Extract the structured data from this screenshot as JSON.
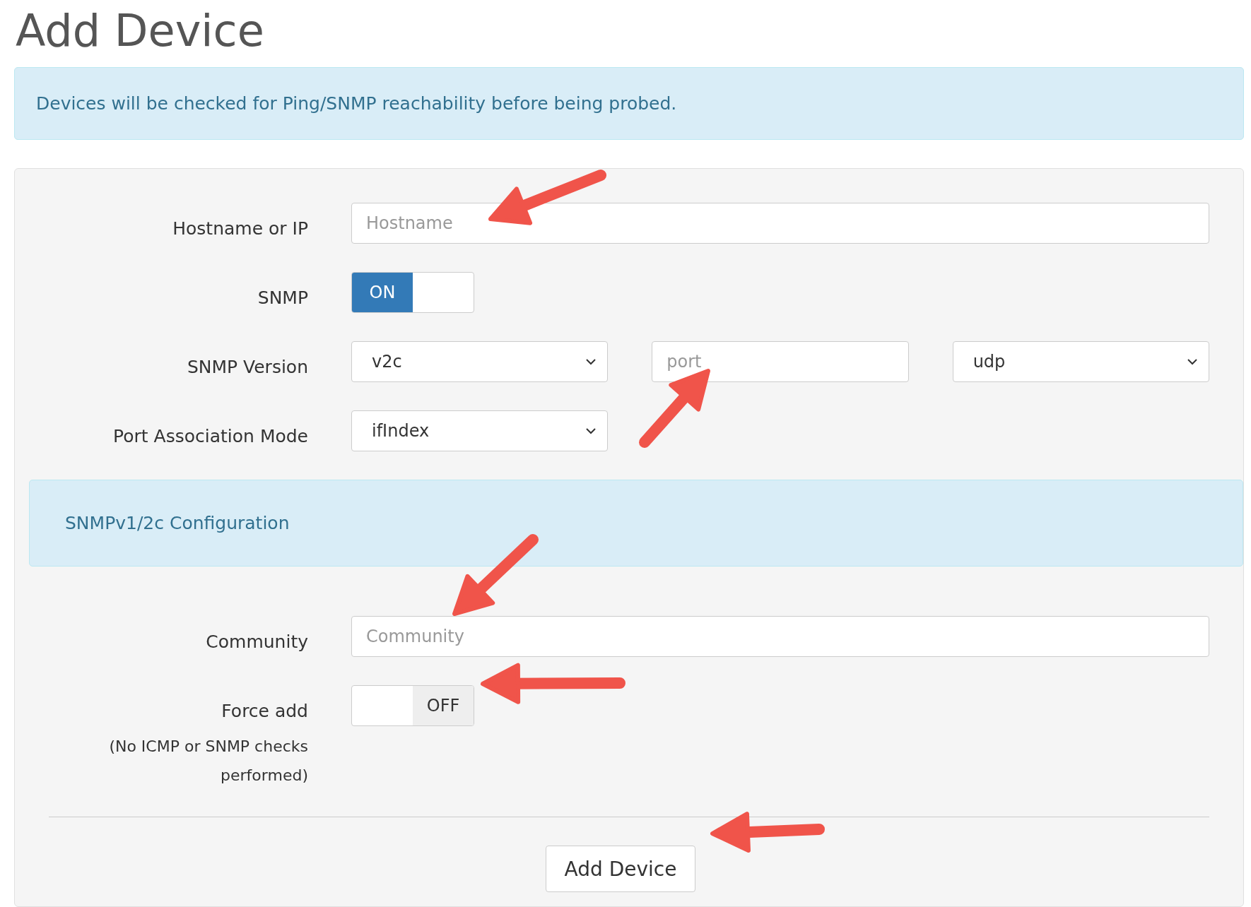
{
  "page": {
    "title": "Add Device"
  },
  "notice": "Devices will be checked for Ping/SNMP reachability before being probed.",
  "form": {
    "fields": [
      {
        "kind": "text",
        "label": "Hostname or IP",
        "placeholder": "Hostname"
      },
      {
        "kind": "toggle",
        "label": "SNMP",
        "on": true,
        "text": "ON"
      },
      {
        "kind": "selects",
        "label": "SNMP Version",
        "version": "v2c",
        "port_placeholder": "port",
        "transport": "udp"
      },
      {
        "kind": "select",
        "label": "Port Association Mode",
        "value": "ifIndex"
      }
    ],
    "section": "SNMPv1/2c Configuration",
    "fields2": [
      {
        "kind": "text",
        "label": "Community",
        "placeholder": "Community"
      },
      {
        "kind": "toggle",
        "label": "Force add",
        "note": "(No ICMP or SNMP checks performed)",
        "on": false,
        "text": "OFF"
      }
    ],
    "submit": "Add Device"
  }
}
